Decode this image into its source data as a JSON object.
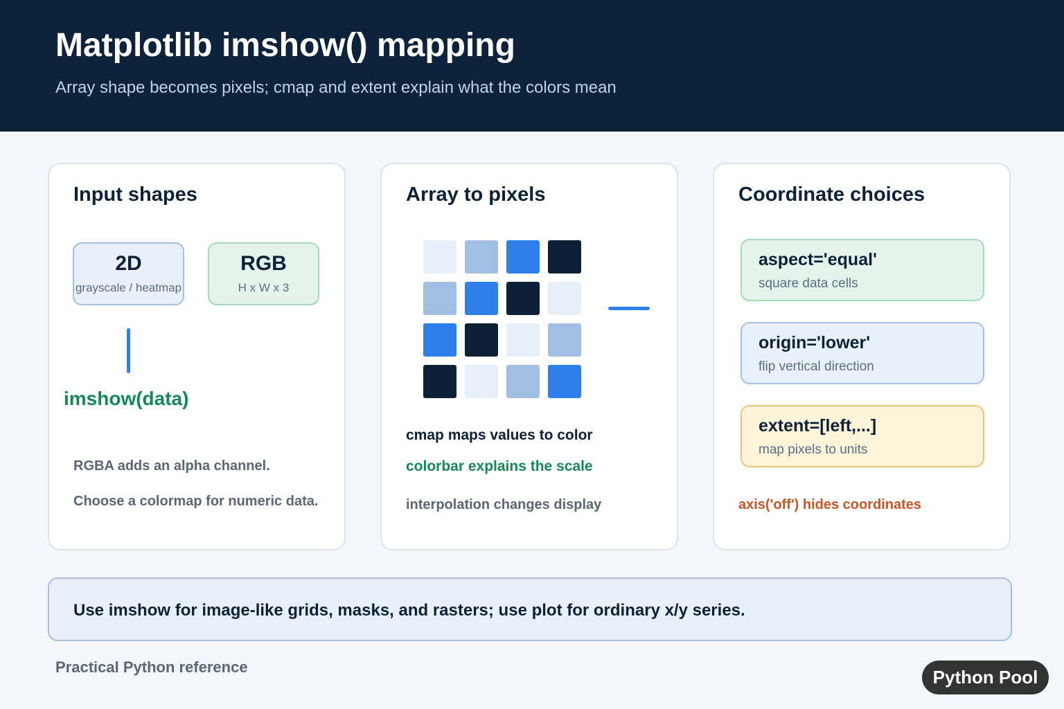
{
  "header": {
    "title": "Matplotlib imshow() mapping",
    "subtitle": "Array shape becomes pixels; cmap and extent explain what the colors mean"
  },
  "input_card": {
    "title": "Input shapes",
    "box_2d": {
      "label": "2D",
      "desc": "grayscale / heatmap"
    },
    "box_rgb": {
      "label": "RGB",
      "desc": "H x W x 3"
    },
    "call": "imshow(data)",
    "note1": "RGBA adds an alpha channel.",
    "note2": "Choose a colormap for numeric data."
  },
  "array_card": {
    "title": "Array to pixels",
    "grid_levels": [
      [
        0,
        1,
        2,
        3
      ],
      [
        1,
        2,
        3,
        0
      ],
      [
        2,
        3,
        0,
        1
      ],
      [
        3,
        0,
        1,
        2
      ]
    ],
    "palette": [
      "#e7eff9",
      "#a1bfe2",
      "#2f7fea",
      "#0d2136"
    ],
    "note1": "cmap maps values to color",
    "note2": "colorbar explains the scale",
    "note3": "interpolation changes display"
  },
  "coord_card": {
    "title": "Coordinate choices",
    "choices": [
      {
        "label": "aspect='equal'",
        "desc": "square data cells"
      },
      {
        "label": "origin='lower'",
        "desc": "flip vertical direction"
      },
      {
        "label": "extent=[left,...]",
        "desc": "map pixels to units"
      }
    ],
    "note": "axis('off') hides coordinates"
  },
  "banner": {
    "text": "Use imshow for image-like grids, masks, and rasters; use plot for ordinary x/y series."
  },
  "footer": {
    "text": "Practical Python reference",
    "brand": "Python Pool"
  },
  "colors": {
    "header_bg": "#0d233b",
    "accent_blue": "#2f80ea",
    "accent_green": "#17875a",
    "accent_orange": "#c4562a"
  }
}
